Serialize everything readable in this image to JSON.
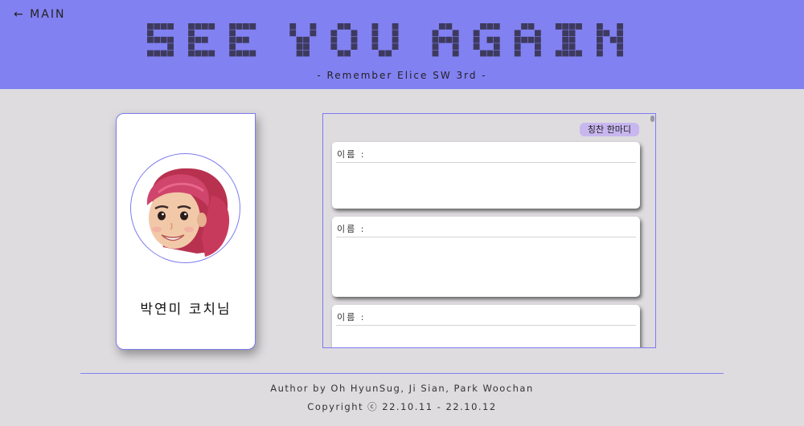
{
  "header": {
    "back_link": "← MAIN",
    "logo_text": "SEE YOU AGAIN",
    "subtitle": "- Remember Elice SW 3rd -",
    "background": "#8281f2",
    "logo_color": "#3d3a5e"
  },
  "profile": {
    "name": "박연미 코치님",
    "avatar": "memoji-avatar",
    "border_color": "#7c7bf0"
  },
  "messages": {
    "praise_button": "칭찬 한마디",
    "cards": [
      {
        "label": "이름 :"
      },
      {
        "label": "이름 :"
      },
      {
        "label": "이름 :"
      }
    ]
  },
  "footer": {
    "author": "Author by Oh HyunSug, Ji Sian, Park Woochan",
    "copyright": "Copyright ⓒ 22.10.11 - 22.10.12"
  }
}
